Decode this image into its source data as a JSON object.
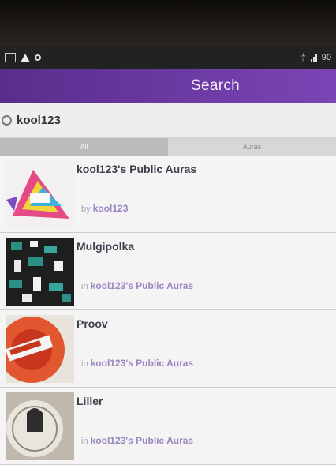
{
  "status_bar": {
    "battery": "90"
  },
  "header": {
    "title": "Search"
  },
  "search": {
    "value": "kool123"
  },
  "tabs": [
    {
      "label": "All"
    },
    {
      "label": "Auras"
    }
  ],
  "results": [
    {
      "title": "kool123's Public Auras",
      "prefix": "by",
      "link": "kool123"
    },
    {
      "title": "Mulgipolka",
      "prefix": "in",
      "link": "kool123's Public Auras"
    },
    {
      "title": "Proov",
      "prefix": "in",
      "link": "kool123's Public Auras"
    },
    {
      "title": "Liller",
      "prefix": "in",
      "link": "kool123's Public Auras"
    }
  ],
  "colors": {
    "title_bar": "#5a2d8c",
    "link": "#9b86c2"
  }
}
